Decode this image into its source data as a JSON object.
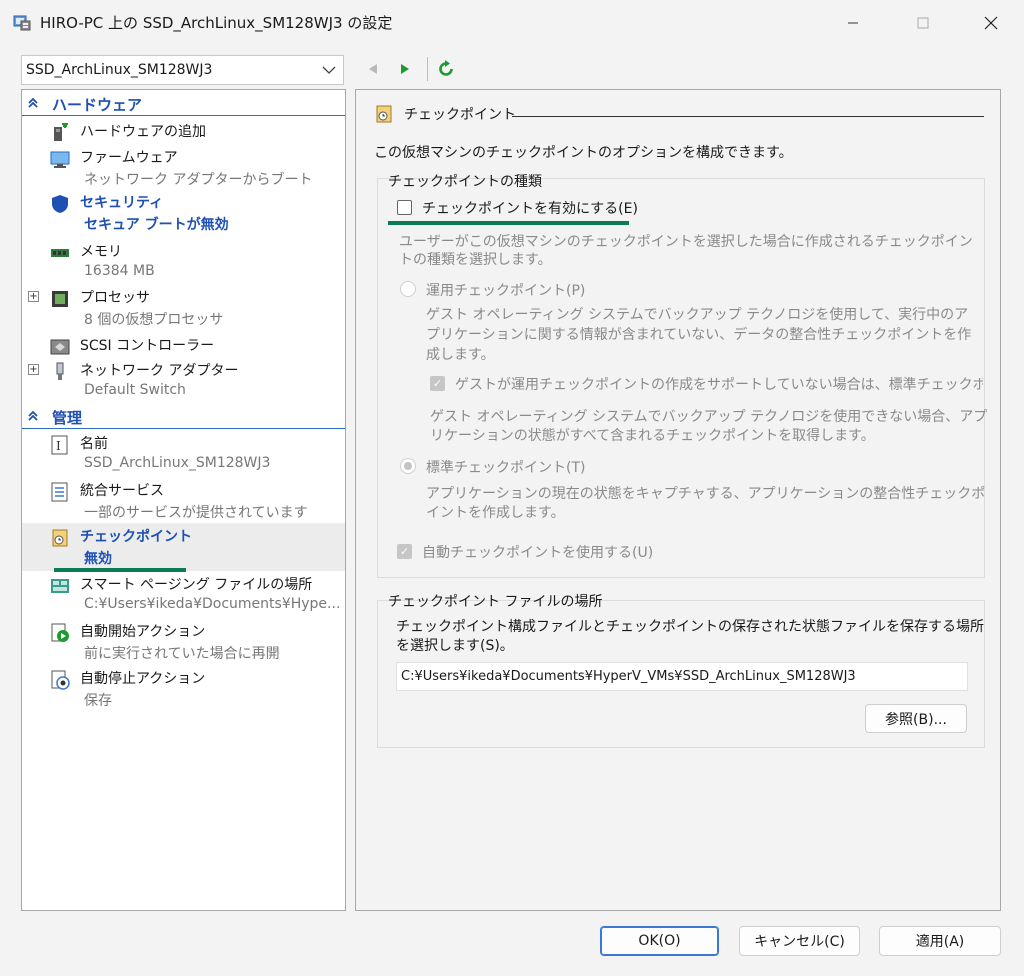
{
  "window": {
    "title": "HIRO-PC 上の SSD_ArchLinux_SM128WJ3 の設定"
  },
  "vm_selector": {
    "value": "SSD_ArchLinux_SM128WJ3"
  },
  "sidebar": {
    "hardware": {
      "label": "ハードウェア",
      "items": [
        {
          "label": "ハードウェアの追加",
          "sub": ""
        },
        {
          "label": "ファームウェア",
          "sub": "ネットワーク アダプターからブート"
        },
        {
          "label": "セキュリティ",
          "sub": "セキュア ブートが無効"
        },
        {
          "label": "メモリ",
          "sub": "16384 MB"
        },
        {
          "label": "プロセッサ",
          "sub": "8 個の仮想プロセッサ"
        },
        {
          "label": "SCSI コントローラー",
          "sub": ""
        },
        {
          "label": "ネットワーク アダプター",
          "sub": "Default Switch"
        }
      ]
    },
    "management": {
      "label": "管理",
      "items": [
        {
          "label": "名前",
          "sub": "SSD_ArchLinux_SM128WJ3"
        },
        {
          "label": "統合サービス",
          "sub": "一部のサービスが提供されています"
        },
        {
          "label": "チェックポイント",
          "sub": "無効"
        },
        {
          "label": "スマート ページング ファイルの場所",
          "sub": "C:¥Users¥ikeda¥Documents¥Hype..."
        },
        {
          "label": "自動開始アクション",
          "sub": "前に実行されていた場合に再開"
        },
        {
          "label": "自動停止アクション",
          "sub": "保存"
        }
      ]
    }
  },
  "panel": {
    "heading": "チェックポイント",
    "description": "この仮想マシンのチェックポイントのオプションを構成できます。",
    "type_group": {
      "title": "チェックポイントの種類",
      "enable_label": "チェックポイントを有効にする(E)",
      "enable_checked": false,
      "hint_line1": "ユーザーがこの仮想マシンのチェックポイントを選択した場合に作成されるチェックポイン",
      "hint_line2": "トの種類を選択します。",
      "production": {
        "label": "運用チェックポイント(P)",
        "desc_line1": "ゲスト オペレーティング システムでバックアップ テクノロジを使用して、実行中のア",
        "desc_line2": "プリケーションに関する情報が含まれていない、データの整合性チェックポイントを作",
        "desc_line3": "成します。",
        "fallback_label": "ゲストが運用チェックポイントの作成をサポートしていない場合は、標準チェックポイ",
        "fallback_checked": true,
        "fallback_desc_line1": "ゲスト オペレーティング システムでバックアップ テクノロジを使用できない場合、アプ",
        "fallback_desc_line2": "リケーションの状態がすべて含まれるチェックポイントを取得します。"
      },
      "standard": {
        "label": "標準チェックポイント(T)",
        "selected": true,
        "desc_line1": "アプリケーションの現在の状態をキャプチャする、アプリケーションの整合性チェックポ",
        "desc_line2": "イントを作成します。"
      },
      "auto_label": "自動チェックポイントを使用する(U)",
      "auto_checked": true
    },
    "location_group": {
      "title": "チェックポイント ファイルの場所",
      "desc_line1": "チェックポイント構成ファイルとチェックポイントの保存された状態ファイルを保存する場所",
      "desc_line2": "を選択します(S)。",
      "path": "C:¥Users¥ikeda¥Documents¥HyperV_VMs¥SSD_ArchLinux_SM128WJ3",
      "browse_label": "参照(B)..."
    }
  },
  "buttons": {
    "ok": "OK(O)",
    "cancel": "キャンセル(C)",
    "apply": "適用(A)"
  },
  "colors": {
    "accent_blue": "#1e50b4",
    "highlight_green": "#0a7b54",
    "play_green": "#1e9a2e"
  }
}
